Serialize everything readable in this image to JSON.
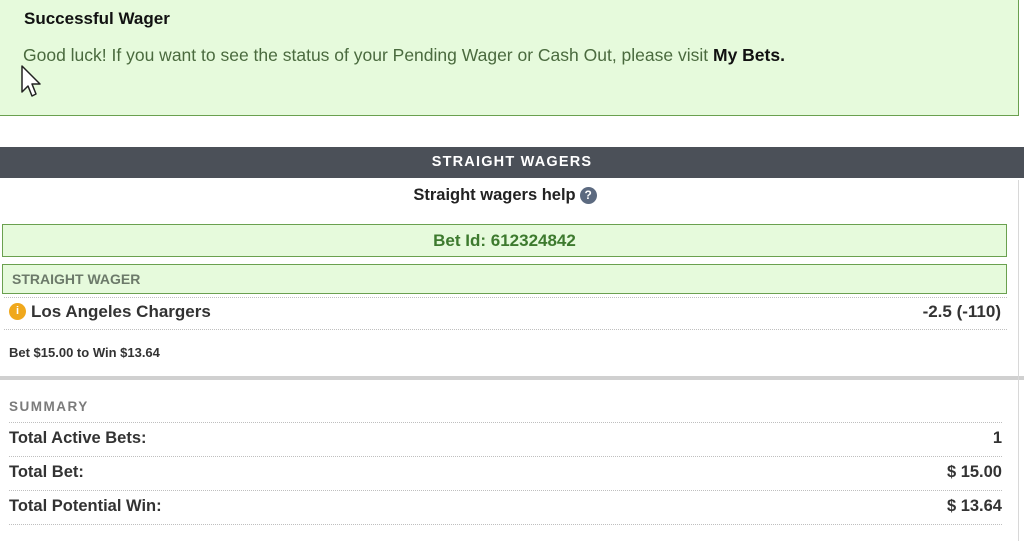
{
  "banner": {
    "title": "Successful Wager",
    "message": "Good luck! If you want to see the status of your Pending Wager or Cash Out, please visit ",
    "link": "My Bets."
  },
  "section": {
    "title": "STRAIGHT WAGERS",
    "help_label": "Straight wagers help",
    "help_icon": "?"
  },
  "bet": {
    "id_label": "Bet Id: 612324842",
    "type": "STRAIGHT WAGER",
    "info_icon": "i",
    "team": "Los Angeles Chargers",
    "odds": "-2.5 (-110)",
    "line": "Bet $15.00 to Win $13.64"
  },
  "summary": {
    "title": "SUMMARY",
    "rows": [
      {
        "label": "Total Active Bets:",
        "value": "1"
      },
      {
        "label": "Total Bet:",
        "value": "$ 15.00"
      },
      {
        "label": "Total Potential Win:",
        "value": "$ 13.64"
      }
    ]
  },
  "colors": {
    "success_bg": "#e6fadc",
    "success_border": "#6aa04f",
    "bar_bg": "#4b5058",
    "bet_id_text": "#3d7a2e",
    "info_icon": "#f0a81c"
  }
}
